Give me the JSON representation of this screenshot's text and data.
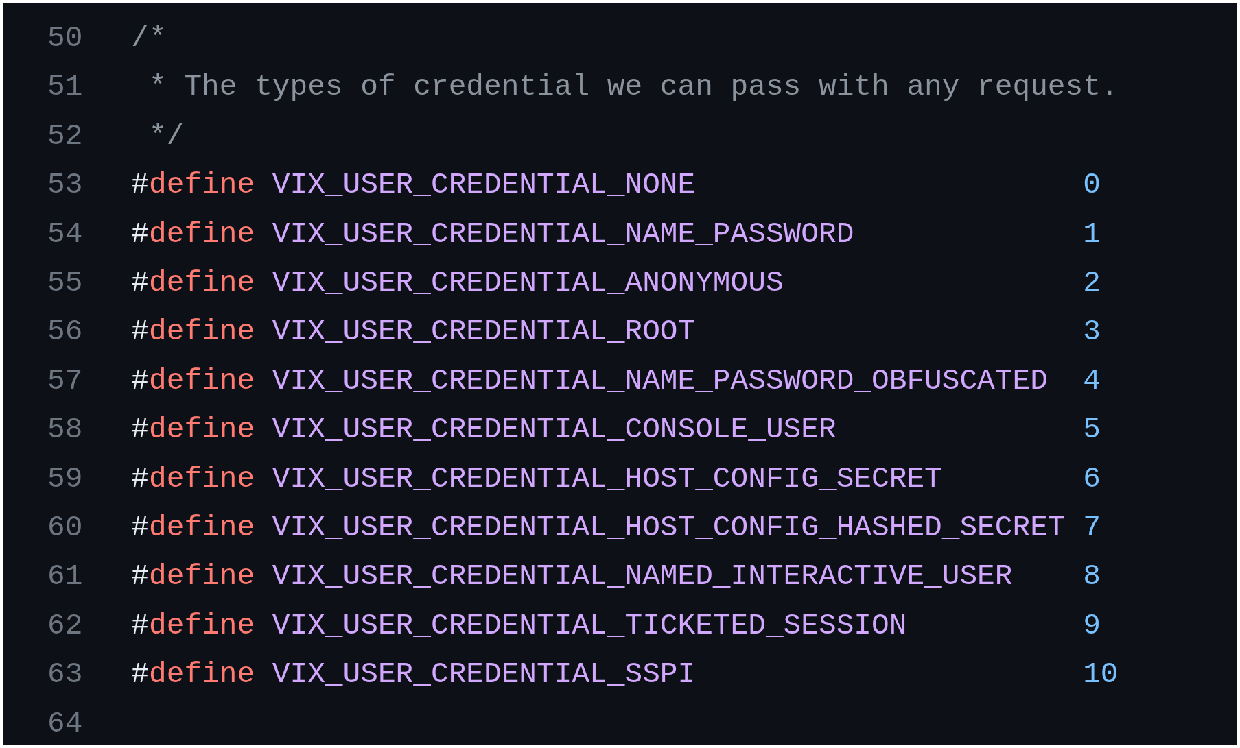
{
  "code_view": {
    "lines": [
      {
        "number": "50",
        "kind": "comment",
        "text": "/*"
      },
      {
        "number": "51",
        "kind": "comment",
        "text": " * The types of credential we can pass with any request."
      },
      {
        "number": "52",
        "kind": "comment",
        "text": " */"
      },
      {
        "number": "53",
        "kind": "define",
        "prefix": "#",
        "keyword": "define",
        "name": "VIX_USER_CREDENTIAL_NONE",
        "value": "0"
      },
      {
        "number": "54",
        "kind": "define",
        "prefix": "#",
        "keyword": "define",
        "name": "VIX_USER_CREDENTIAL_NAME_PASSWORD",
        "value": "1"
      },
      {
        "number": "55",
        "kind": "define",
        "prefix": "#",
        "keyword": "define",
        "name": "VIX_USER_CREDENTIAL_ANONYMOUS",
        "value": "2"
      },
      {
        "number": "56",
        "kind": "define",
        "prefix": "#",
        "keyword": "define",
        "name": "VIX_USER_CREDENTIAL_ROOT",
        "value": "3"
      },
      {
        "number": "57",
        "kind": "define",
        "prefix": "#",
        "keyword": "define",
        "name": "VIX_USER_CREDENTIAL_NAME_PASSWORD_OBFUSCATED",
        "value": "4"
      },
      {
        "number": "58",
        "kind": "define",
        "prefix": "#",
        "keyword": "define",
        "name": "VIX_USER_CREDENTIAL_CONSOLE_USER",
        "value": "5"
      },
      {
        "number": "59",
        "kind": "define",
        "prefix": "#",
        "keyword": "define",
        "name": "VIX_USER_CREDENTIAL_HOST_CONFIG_SECRET",
        "value": "6"
      },
      {
        "number": "60",
        "kind": "define",
        "prefix": "#",
        "keyword": "define",
        "name": "VIX_USER_CREDENTIAL_HOST_CONFIG_HASHED_SECRET",
        "value": "7"
      },
      {
        "number": "61",
        "kind": "define",
        "prefix": "#",
        "keyword": "define",
        "name": "VIX_USER_CREDENTIAL_NAMED_INTERACTIVE_USER",
        "value": "8"
      },
      {
        "number": "62",
        "kind": "define",
        "prefix": "#",
        "keyword": "define",
        "name": "VIX_USER_CREDENTIAL_TICKETED_SESSION",
        "value": "9"
      },
      {
        "number": "63",
        "kind": "define",
        "prefix": "#",
        "keyword": "define",
        "name": "VIX_USER_CREDENTIAL_SSPI",
        "value": "10"
      },
      {
        "number": "64",
        "kind": "blank"
      }
    ]
  }
}
